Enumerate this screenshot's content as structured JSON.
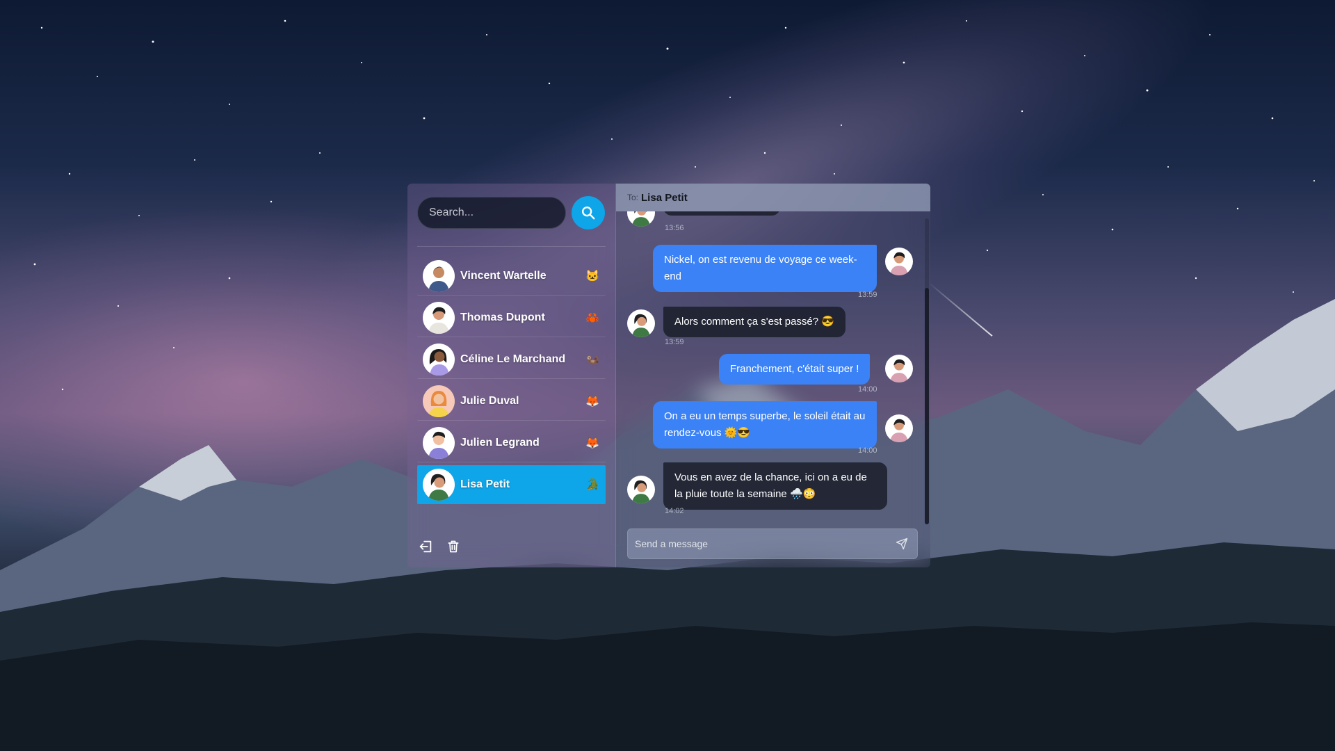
{
  "search": {
    "placeholder": "Search..."
  },
  "contacts": [
    {
      "name": "Vincent Wartelle",
      "emoji": "🐱"
    },
    {
      "name": "Thomas Dupont",
      "emoji": "🦀"
    },
    {
      "name": "Céline Le Marchand",
      "emoji": "🦦"
    },
    {
      "name": "Julie Duval",
      "emoji": "🦊"
    },
    {
      "name": "Julien Legrand",
      "emoji": "🦊"
    },
    {
      "name": "Lisa Petit",
      "emoji": "🐊"
    }
  ],
  "active_contact": "Lisa Petit",
  "chat": {
    "to_label": "To:",
    "to_name": "Lisa Petit",
    "messages": [
      {
        "dir": "in",
        "text": "",
        "time": "13:56"
      },
      {
        "dir": "out",
        "text": "Nickel, on est revenu de voyage ce week-end",
        "time": "13:59"
      },
      {
        "dir": "in",
        "text": "Alors comment ça s'est passé? 😎",
        "time": "13:59"
      },
      {
        "dir": "out",
        "text": "Franchement, c'était super !",
        "time": "14:00"
      },
      {
        "dir": "out",
        "text": "On a eu un temps superbe, le soleil était au rendez-vous 🌞😎",
        "time": "14:00"
      },
      {
        "dir": "in",
        "text": "Vous en avez de la chance, ici on a eu de la pluie toute la semaine 🌧️😳",
        "time": "14:02"
      }
    ]
  },
  "composer": {
    "placeholder": "Send a message"
  },
  "icons": {
    "search": "search-icon",
    "logout": "logout-icon",
    "trash": "trash-icon",
    "send": "send-icon"
  },
  "colors": {
    "accent": "#0ea5e9",
    "outgoing": "#3b82f6",
    "incoming": "#1c202c"
  }
}
